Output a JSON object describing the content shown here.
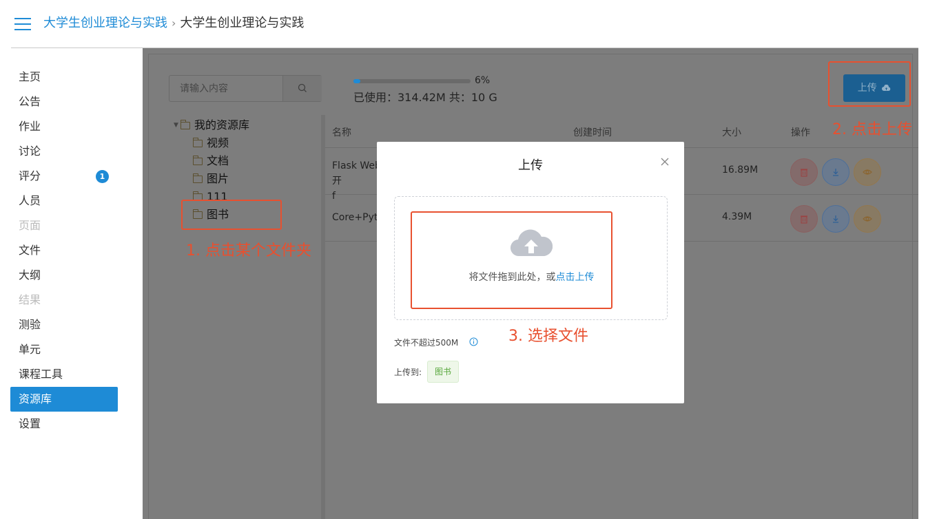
{
  "header": {
    "breadcrumb_root": "大学生创业理论与实践",
    "breadcrumb_separator": "›",
    "breadcrumb_current": "大学生创业理论与实践"
  },
  "sidebar": {
    "items": [
      {
        "label": "主页"
      },
      {
        "label": "公告"
      },
      {
        "label": "作业"
      },
      {
        "label": "讨论"
      },
      {
        "label": "评分",
        "badge": "1"
      },
      {
        "label": "人员"
      },
      {
        "label": "页面",
        "disabled": true
      },
      {
        "label": "文件"
      },
      {
        "label": "大纲"
      },
      {
        "label": "结果",
        "disabled": true
      },
      {
        "label": "测验"
      },
      {
        "label": "单元"
      },
      {
        "label": "课程工具"
      },
      {
        "label": "资源库",
        "active": true
      },
      {
        "label": "设置"
      }
    ]
  },
  "toolbar": {
    "search_placeholder": "请输入内容",
    "quota_percent_label": "6%",
    "quota_fraction": 0.06,
    "quota_text": "已使用：314.42M 共：10 G",
    "upload_label": "上传"
  },
  "tree": {
    "root": "我的资源库",
    "children": [
      "视频",
      "文档",
      "图片",
      "111",
      "图书"
    ]
  },
  "table": {
    "headers": {
      "name": "名称",
      "created": "创建时间",
      "size": "大小",
      "actions": "操作"
    },
    "rows": [
      {
        "name_line1": "Flask Web开",
        "name_line2": "f",
        "size": "16.89M"
      },
      {
        "name_line1": "Core+Pytho",
        "name_line2": "",
        "size": "4.39M"
      }
    ]
  },
  "modal": {
    "title": "上传",
    "drop_text": "将文件拖到此处，或",
    "drop_link": "点击上传",
    "limit_text": "文件不超过500M",
    "dest_label": "上传到:",
    "dest_tag": "图书"
  },
  "annotations": {
    "step1": "1. 点击某个文件夹",
    "step2": "2. 点击上传",
    "step3": "3. 选择文件"
  },
  "colors": {
    "accent": "#1e8bd6",
    "annotation": "#e8502f",
    "tag_green": "#57a73b"
  }
}
